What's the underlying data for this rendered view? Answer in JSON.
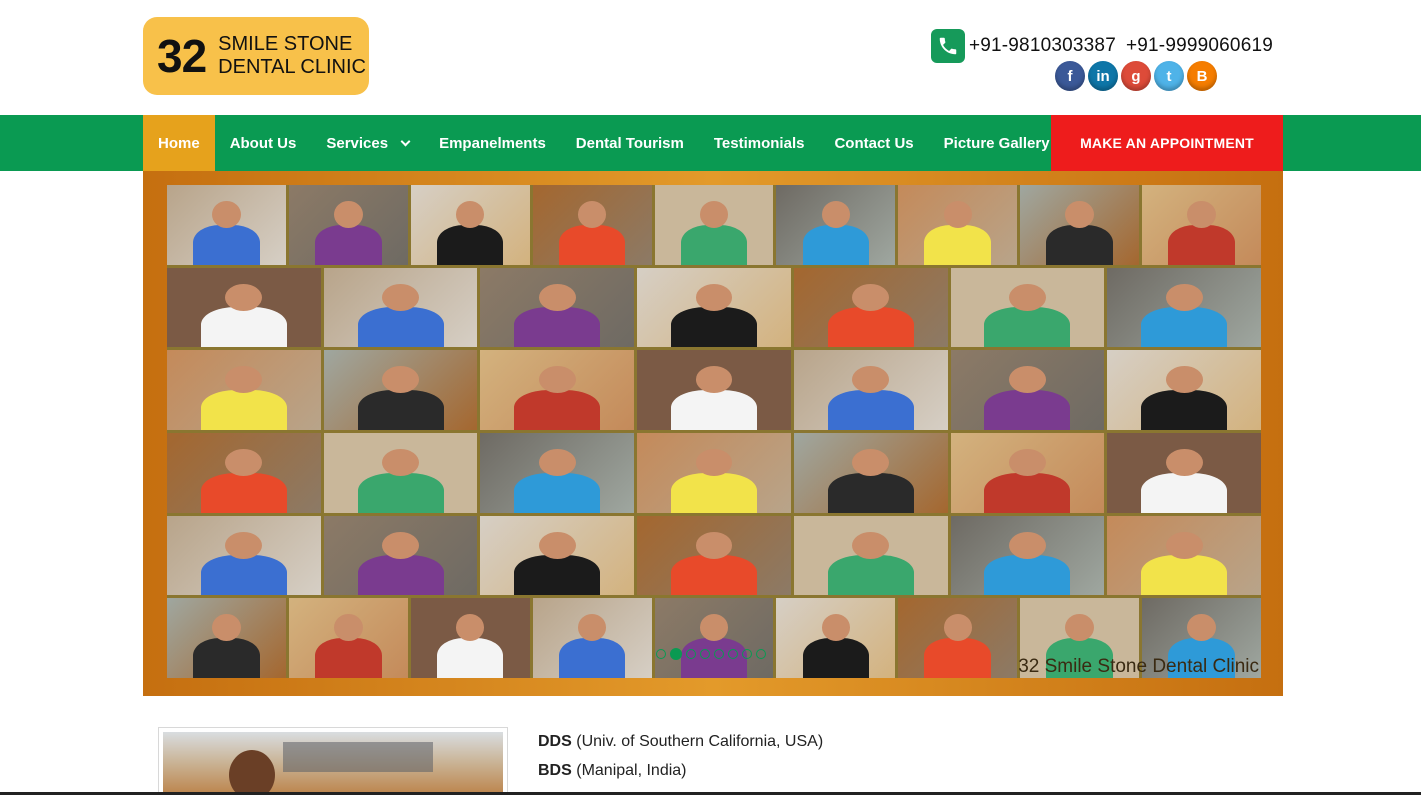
{
  "logo": {
    "number": "32",
    "line1": "SMILE STONE",
    "line2": "DENTAL CLINIC"
  },
  "header": {
    "phones": [
      "+91-9810303387",
      "+91-9999060619"
    ],
    "social": [
      {
        "icon": "facebook-icon",
        "glyph": "f",
        "color": "#3b5998"
      },
      {
        "icon": "linkedin-icon",
        "glyph": "in",
        "color": "#0e76a8"
      },
      {
        "icon": "googleplus-icon",
        "glyph": "g",
        "color": "#dd4b39"
      },
      {
        "icon": "twitter-icon",
        "glyph": "t",
        "color": "#4fb3e8"
      },
      {
        "icon": "blogger-icon",
        "glyph": "B",
        "color": "#f57d00"
      }
    ]
  },
  "nav": {
    "items": [
      "Home",
      "About Us",
      "Services",
      "Empanelments",
      "Dental Tourism",
      "Testimonials",
      "Contact Us",
      "Picture Gallery"
    ],
    "active": "Home",
    "cta": "MAKE AN APPOINTMENT",
    "colors": {
      "bar": "#0a9a52",
      "active": "#e6a21c",
      "cta": "#ee1c1c"
    }
  },
  "slider": {
    "caption": "32 Smile Stone Dental Clinic",
    "dot_count": 8,
    "active_dot": 1
  },
  "content": {
    "qualifications": [
      {
        "degree": "DDS",
        "detail": "(Univ. of Southern California, USA)"
      },
      {
        "degree": "BDS",
        "detail": "(Manipal, India)"
      }
    ]
  }
}
